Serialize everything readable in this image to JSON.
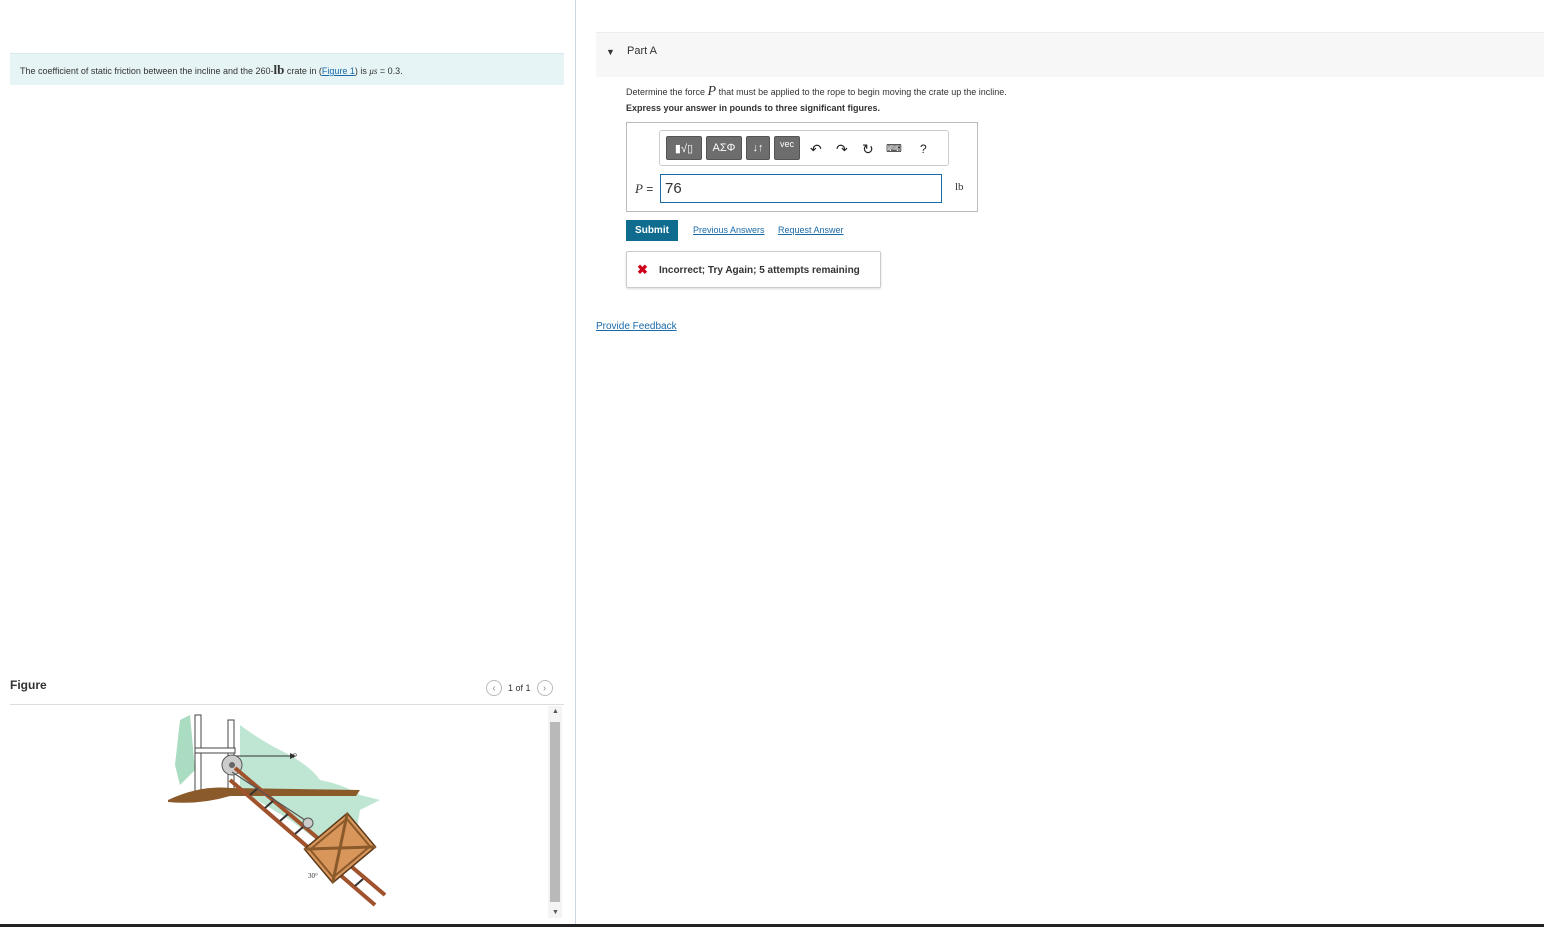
{
  "problem": {
    "text_pre": "The coefficient of static friction between the incline and the 260-",
    "unit_bold": "lb",
    "text_mid": " crate in (",
    "figure_link": "Figure 1",
    "text_post": ") is ",
    "mu_symbol": "μs",
    "mu_value": " = 0.3."
  },
  "figure_panel": {
    "title": "Figure",
    "pager": "1 of 1",
    "prev_icon": "chevron-left-icon",
    "next_icon": "chevron-right-icon",
    "labels": {
      "force": "P",
      "angle": "30°"
    }
  },
  "part": {
    "label": "Part A",
    "toggle_icon": "caret-down-icon"
  },
  "question": {
    "line1_pre": "Determine the force ",
    "line1_var": "P",
    "line1_post": " that must be applied to the rope to begin moving the crate up the incline.",
    "line2": "Express your answer in pounds to three significant figures."
  },
  "toolbar": {
    "templates": "▮√▯",
    "greek": "ΑΣΦ",
    "arrows": "↓↑",
    "vec": "vec",
    "undo_icon": "undo-icon",
    "redo_icon": "redo-icon",
    "reset_icon": "reset-icon",
    "keyboard_icon": "keyboard-icon",
    "help": "?"
  },
  "answer": {
    "label_var": "P",
    "label_eq": " =",
    "value": "76",
    "unit": "lb"
  },
  "actions": {
    "submit": "Submit",
    "previous_answers": "Previous Answers",
    "request_answer": "Request Answer"
  },
  "feedback": {
    "icon": "x-icon",
    "message": "Incorrect; Try Again; 5 attempts remaining"
  },
  "provide_feedback": "Provide Feedback",
  "colors": {
    "link": "#1a6aa8",
    "submit": "#0f6c8f",
    "problem_bg": "#e6f4f5",
    "error": "#d0021b"
  }
}
